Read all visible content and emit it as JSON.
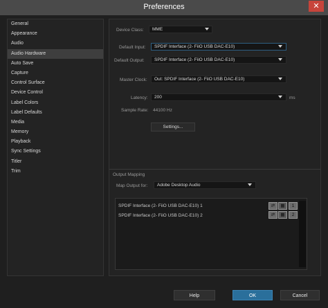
{
  "window": {
    "title": "Preferences",
    "close_glyph": "✕"
  },
  "sidebar": {
    "items": [
      {
        "label": "General"
      },
      {
        "label": "Appearance"
      },
      {
        "label": "Audio"
      },
      {
        "label": "Audio Hardware"
      },
      {
        "label": "Auto Save"
      },
      {
        "label": "Capture"
      },
      {
        "label": "Control Surface"
      },
      {
        "label": "Device Control"
      },
      {
        "label": "Label Colors"
      },
      {
        "label": "Label Defaults"
      },
      {
        "label": "Media"
      },
      {
        "label": "Memory"
      },
      {
        "label": "Playback"
      },
      {
        "label": "Sync Settings"
      },
      {
        "label": "Titler"
      },
      {
        "label": "Trim"
      }
    ],
    "selected_label": "Audio Hardware"
  },
  "audio_hardware": {
    "device_class_label": "Device Class:",
    "device_class_value": "MME",
    "default_input_label": "Default Input:",
    "default_input_value": "SPDIF Interface (2- FiiO USB DAC-E10)",
    "default_output_label": "Default Output:",
    "default_output_value": "SPDIF Interface (2- FiiO USB DAC-E10)",
    "master_clock_label": "Master Clock:",
    "master_clock_value": "Out: SPDIF Interface (2- FiiO USB DAC-E10)",
    "latency_label": "Latency:",
    "latency_value": "200",
    "latency_unit": "ms",
    "sample_rate_label": "Sample Rate:",
    "sample_rate_value": "44100 Hz",
    "settings_button": "Settings..."
  },
  "output_mapping": {
    "section_label": "Output Mapping",
    "map_output_for_label": "Map Output for:",
    "map_output_for_value": "Adobe Desktop Audio",
    "channels": [
      {
        "name": "SPDIF Interface (2- FiiO USB DAC-E10) 1",
        "channel_number": "1"
      },
      {
        "name": "SPDIF Interface (2- FiiO USB DAC-E10) 2",
        "channel_number": "2"
      }
    ]
  },
  "footer": {
    "help": "Help",
    "ok": "OK",
    "cancel": "Cancel"
  },
  "colors": {
    "accent": "#2a6f9b",
    "close": "#c7443b",
    "background": "#1f1f1f"
  }
}
